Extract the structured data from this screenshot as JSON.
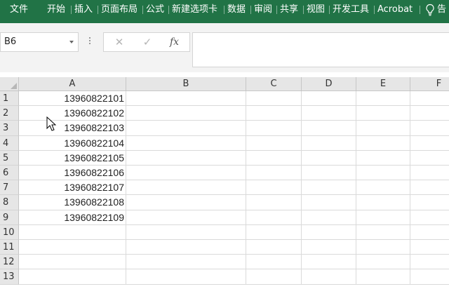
{
  "ribbon": {
    "tabs": [
      "文件",
      "开始",
      "插入",
      "页面布局",
      "公式",
      "新建选项卡",
      "数据",
      "审阅",
      "共享",
      "视图",
      "开发工具",
      "Acrobat"
    ],
    "tell_me": "告"
  },
  "formula_bar": {
    "name_box": "B6",
    "cancel_symbol": "✕",
    "enter_symbol": "✓",
    "fx_label": "fx",
    "formula_value": ""
  },
  "sheet": {
    "columns": [
      "A",
      "B",
      "C",
      "D",
      "E",
      "F"
    ],
    "rows": [
      "1",
      "2",
      "3",
      "4",
      "5",
      "6",
      "7",
      "8",
      "9",
      "10",
      "11",
      "12",
      "13"
    ],
    "column_a_values": [
      "13960822101",
      "13960822102",
      "13960822103",
      "13960822104",
      "13960822105",
      "13960822106",
      "13960822107",
      "13960822108",
      "13960822109"
    ]
  },
  "colors": {
    "ribbon_green": "#217346",
    "header_gray": "#e6e6e6",
    "grid_line": "#dadada"
  },
  "icons": {
    "tell_me": "lightbulb-icon",
    "name_box_dropdown": "chevron-down-icon",
    "cursor": "mouse-pointer-icon"
  }
}
